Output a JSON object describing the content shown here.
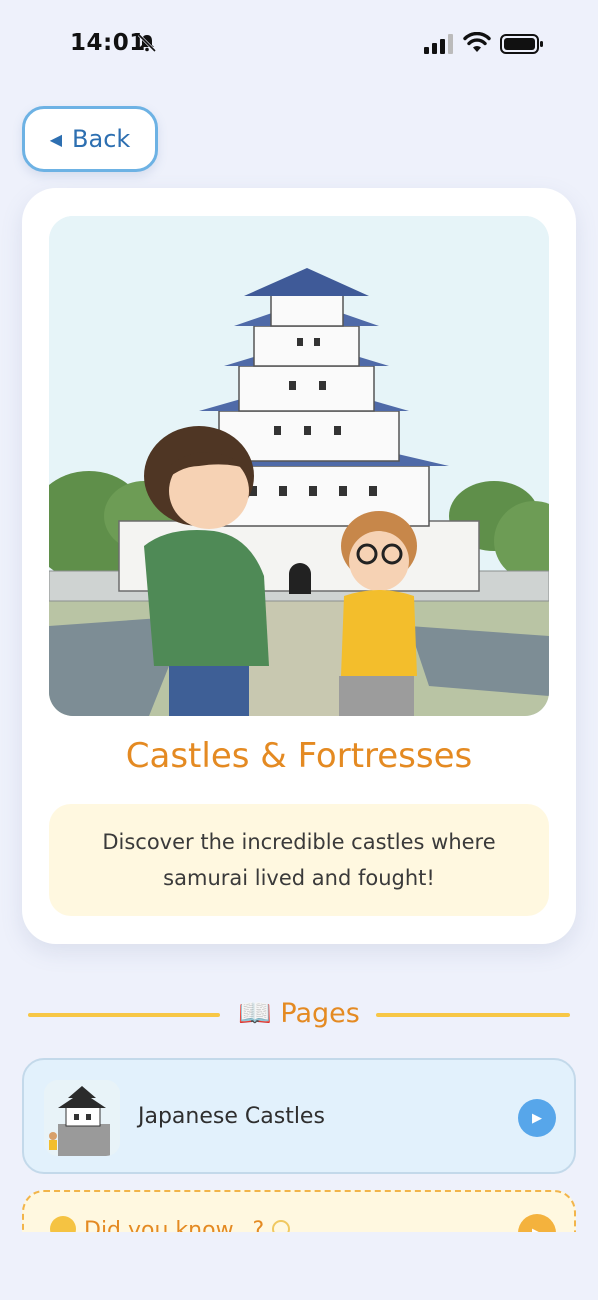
{
  "status_bar": {
    "time": "14:01"
  },
  "nav": {
    "back_label": "Back",
    "back_arrow": "◀"
  },
  "hero": {
    "image_icon": "castle-illustration",
    "title": "Castles & Fortresses",
    "description": "Discover the incredible castles where samurai lived and fought!"
  },
  "pages_section": {
    "icon": "📖",
    "title": "Pages",
    "items": [
      {
        "label": "Japanese Castles",
        "thumb_icon": "castle-thumbnail",
        "play_icon": "▶"
      }
    ]
  },
  "fact_card": {
    "title": "Did you know...?",
    "play_icon": "▶"
  },
  "colors": {
    "accent_orange": "#e48a22",
    "accent_blue": "#57a6ea",
    "background": "#eef1fb",
    "desc_bg": "#fff8e0"
  }
}
